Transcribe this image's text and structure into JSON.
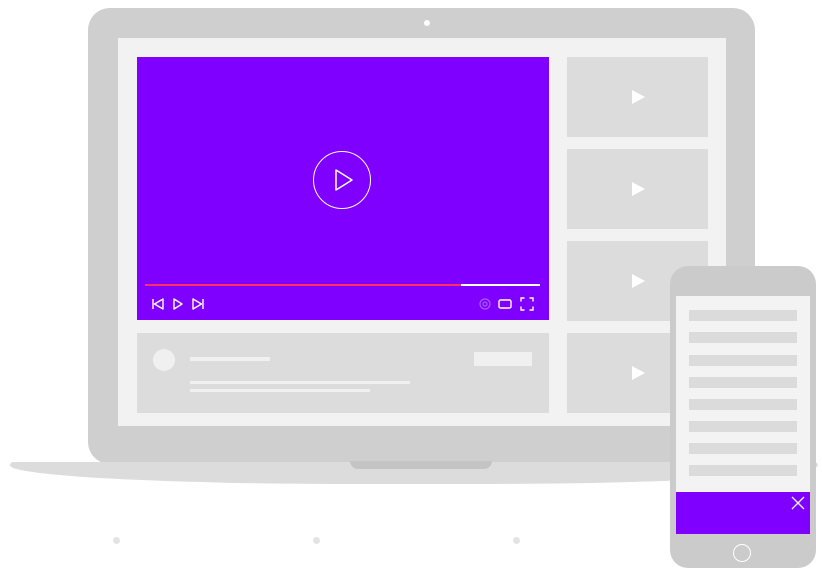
{
  "colors": {
    "accent": "#8000ff",
    "progress": "#ff2f66",
    "device_frame": "#cfcfd0",
    "placeholder": "#dcdcdc"
  },
  "player": {
    "progress_fraction": 0.8,
    "big_play_icon": "play-circle-icon",
    "controls_left": [
      "previous-icon",
      "play-icon",
      "next-icon"
    ],
    "controls_right": [
      "settings-icon",
      "theater-mode-icon",
      "fullscreen-icon"
    ]
  },
  "sidebar": {
    "thumbnail_icon": "play-icon",
    "thumbnail_count": 4
  },
  "phone": {
    "banner_close_icon": "close-icon",
    "home_icon": "home-button-icon"
  },
  "pagination": {
    "dot_count": 3
  }
}
